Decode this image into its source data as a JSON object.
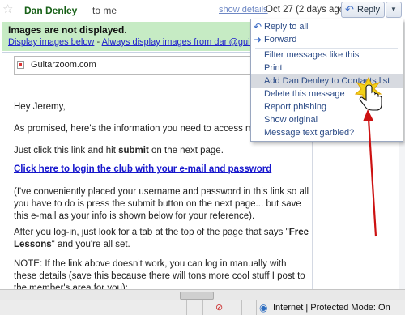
{
  "header": {
    "sender": "Dan Denley",
    "to_me": "to me",
    "show_details": "show details",
    "date": "Oct 27 (2 days ago)",
    "reply_label": "Reply"
  },
  "notice": {
    "title": "Images are not displayed.",
    "display_below": "Display images below",
    "separator": " - ",
    "always_display": "Always display images from dan@guitarzoom.com"
  },
  "email": {
    "logo_alt": "Guitarzoom.com",
    "greeting": "Hey Jeremy,",
    "p1": "As promised, here's the information you need to access my online",
    "p2_pre": "Just click this link and hit ",
    "p2_bold": "submit",
    "p2_post": " on the next page.",
    "login_link": "Click here to login the club with your e-mail and password",
    "p3": "(I've conveniently placed your username and password in this link so all you have to do is press the submit button on the next page... but save this e-mail as your info is shown below for your reference).",
    "p4_pre": "After you log-in, just look for a tab at the top of the page that says \"",
    "p4_bold": "Free Lessons",
    "p4_post": "\" and you're all set.",
    "p5": "NOTE: If the link above doesn't work, you can log in manually with these details (save this because there will tons more cool stuff I post to the member's area for you):"
  },
  "menu": {
    "items": [
      {
        "label": "Reply to all",
        "icon": "reply-all-icon"
      },
      {
        "label": "Forward",
        "icon": "forward-icon"
      },
      {
        "label": "Filter messages like this"
      },
      {
        "label": "Print"
      },
      {
        "label": "Add Dan Denley to Contacts list"
      },
      {
        "label": "Delete this message"
      },
      {
        "label": "Report phishing"
      },
      {
        "label": "Show original"
      },
      {
        "label": "Message text garbled?"
      }
    ]
  },
  "status": {
    "zone": "Internet | Protected Mode: On"
  },
  "colors": {
    "sender": "#176017",
    "notice_bg": "#c6ebc4",
    "link": "#2020cc",
    "menu_highlight": "#d7dae0",
    "arrow": "#cc1111"
  }
}
